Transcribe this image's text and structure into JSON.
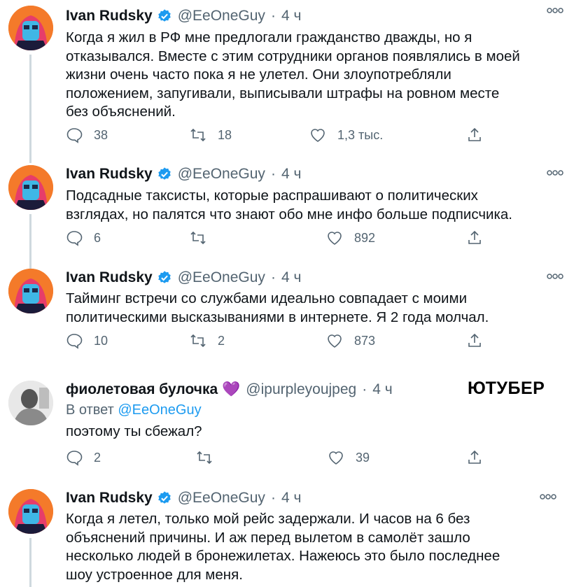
{
  "tweets": [
    {
      "name": "Ivan Rudsky",
      "handle": "@EeOneGuy",
      "dot": "·",
      "time": "4 ч",
      "text": "Когда я жил в РФ мне предлогали гражданство дважды, но я\nотказывался. Вместе с этим сотрудники органов появлялись в моей\nжизни очень часто пока я не улетел. Они злоупотребляли\nположением, запугивали, выписывали штрафы на ровном месте\nбез объяснений.",
      "replies": "38",
      "retweets": "18",
      "likes": "1,3 тыс."
    },
    {
      "name": "Ivan Rudsky",
      "handle": "@EeOneGuy",
      "dot": "·",
      "time": "4 ч",
      "text": "Подсадные таксисты, которые распрашивают о политических\nвзглядах, но палятся что знают обо мне инфо больше подписчика.",
      "replies": "6",
      "retweets": "",
      "likes": "892"
    },
    {
      "name": "Ivan Rudsky",
      "handle": "@EeOneGuy",
      "dot": "·",
      "time": "4 ч",
      "text": "Тайминг встречи со службами идеально совпадает с моими\nполитическими высказываниями в интернете. Я 2 года молчал.",
      "replies": "10",
      "retweets": "2",
      "likes": "873"
    },
    {
      "name": "фиолетовая булочка",
      "name_emoji": "💜",
      "handle": "@ipurpleyoujpeg",
      "dot": "·",
      "time": "4 ч",
      "reply_prefix": "В ответ",
      "reply_mention": "@EeOneGuy",
      "text": "поэтому ты сбежал?",
      "replies": "2",
      "retweets": "",
      "likes": "39"
    },
    {
      "name": "Ivan Rudsky",
      "handle": "@EeOneGuy",
      "dot": "·",
      "time": "4 ч",
      "text": "Когда я летел, только мой рейс задержали. И часов на 6 без\nобъяснений причины. И аж перед вылетом в самолёт зашло\nнесколько людей в бронежилетах. Нажеюсь это было последнее\nшоу устроенное для меня."
    }
  ],
  "annotation": "ЮТУБЕР",
  "colors": {
    "verified": "#1d9bf0",
    "muted": "#536471",
    "thread_line": "#cfd9de",
    "heart": "#9f6ad9"
  }
}
